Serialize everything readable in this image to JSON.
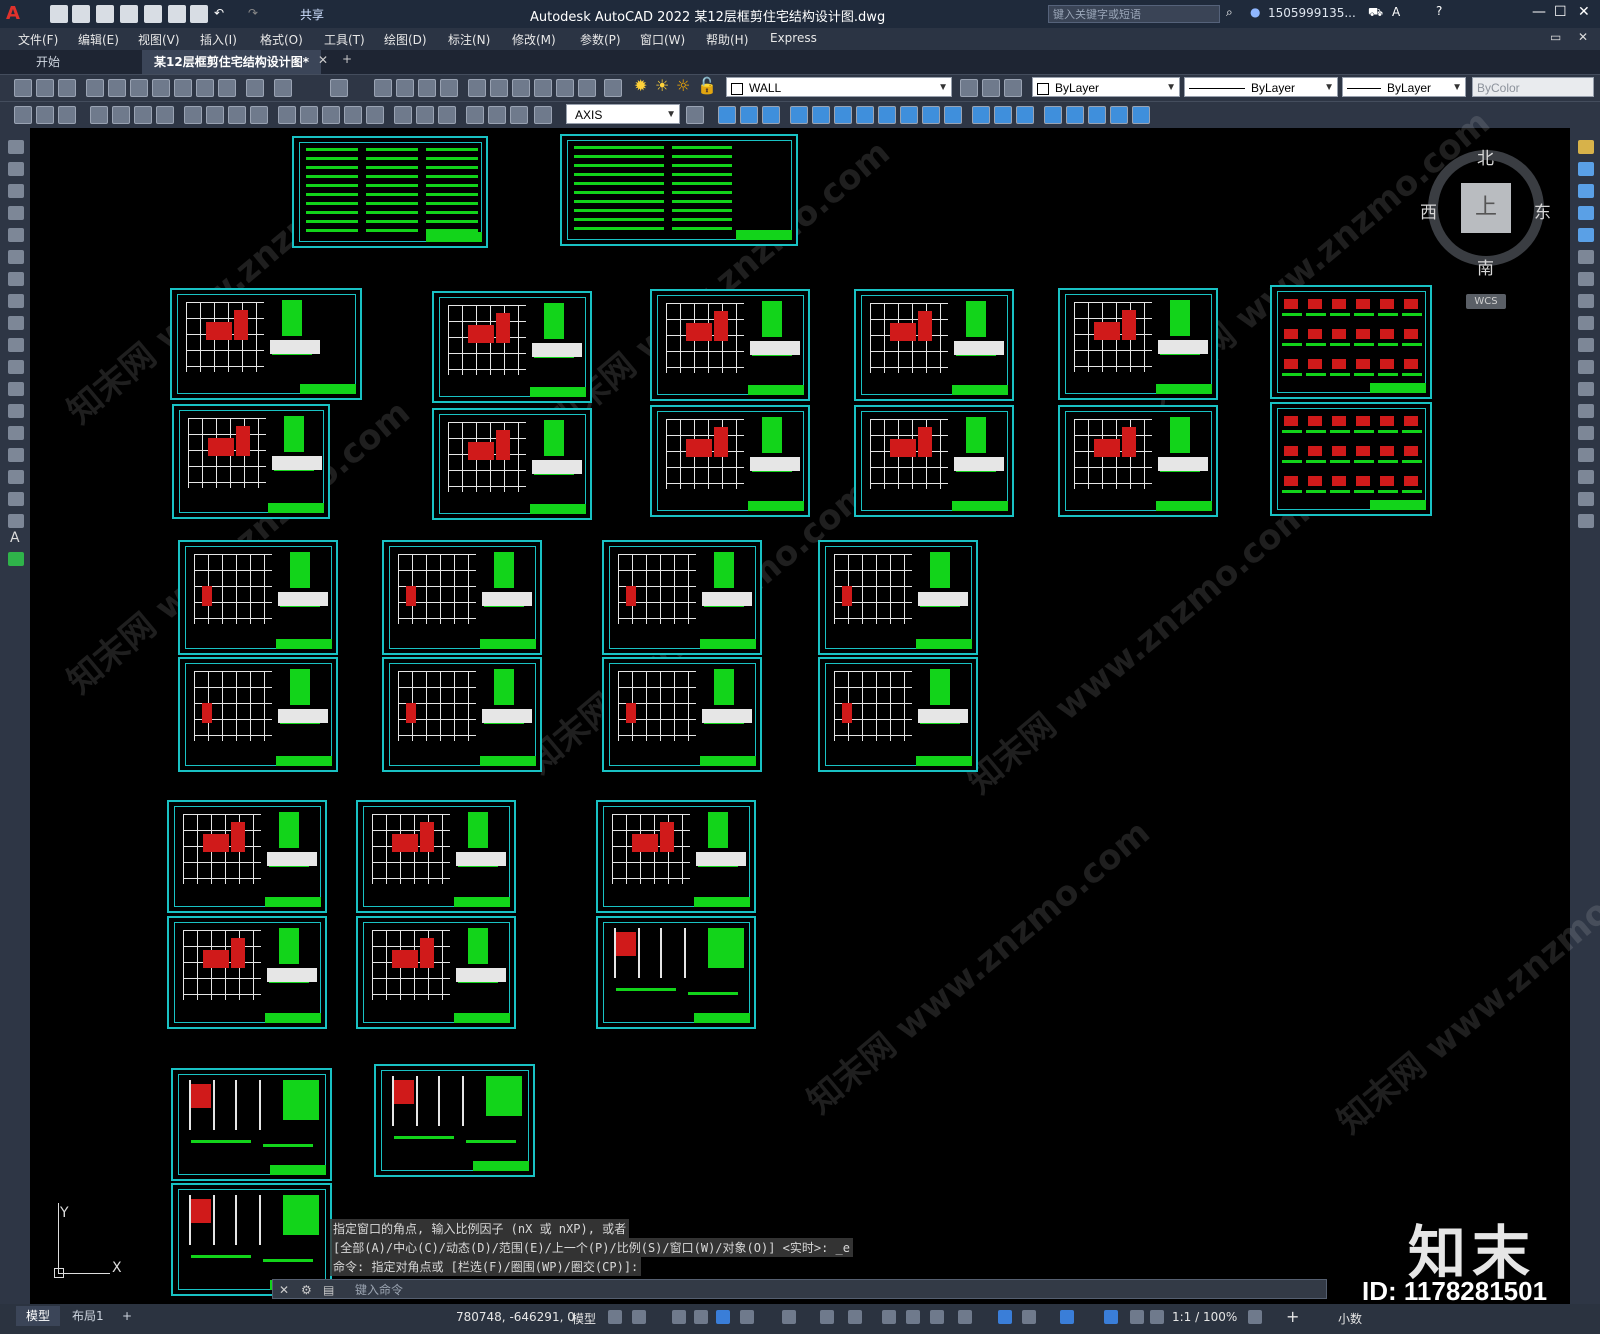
{
  "titlebar": {
    "share_label": "共享",
    "title": "Autodesk AutoCAD 2022    某12层框剪住宅结构设计图.dwg",
    "search_placeholder": "键入关键字或短语",
    "user": "1505999135..."
  },
  "menu": [
    "文件(F)",
    "编辑(E)",
    "视图(V)",
    "插入(I)",
    "格式(O)",
    "工具(T)",
    "绘图(D)",
    "标注(N)",
    "修改(M)",
    "参数(P)",
    "窗口(W)",
    "帮助(H)",
    "Express"
  ],
  "tabs": {
    "start": "开始",
    "drawing": "某12层框剪住宅结构设计图*",
    "add": "+"
  },
  "toolbar": {
    "layer": "WALL",
    "color": "ByLayer",
    "linetype": "ByLayer",
    "lineweight": "ByLayer",
    "plotstyle": "ByColor",
    "dimstyle": "AXIS"
  },
  "viewcube": {
    "north": "北",
    "south": "南",
    "east": "东",
    "west": "西",
    "face": "上",
    "wcs": "WCS"
  },
  "ucs": {
    "y": "Y",
    "x": "X"
  },
  "command": {
    "line1": "指定窗口的角点, 输入比例因子 (nX 或 nXP), 或者",
    "line2": "[全部(A)/中心(C)/动态(D)/范围(E)/上一个(P)/比例(S)/窗口(W)/对象(O)] <实时>: _e",
    "line3": "命令: 指定对角点或 [栏选(F)/圈围(WP)/圈交(CP)]:",
    "input_placeholder": "键入命令"
  },
  "status": {
    "model_tab": "模型",
    "layout_tab": "布局1",
    "add": "+",
    "coords": "780748, -646291, 0",
    "space": "模型",
    "scale": "1:1 / 100%",
    "units": "小数"
  },
  "watermark": {
    "logo": "知末",
    "id": "ID: 1178281501",
    "text": "知末网 www.znzmo.com"
  }
}
